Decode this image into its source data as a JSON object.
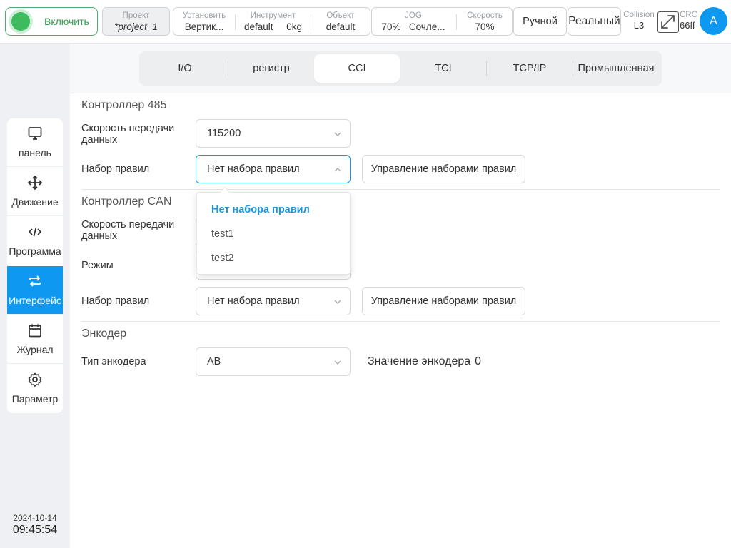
{
  "topbar": {
    "power_label": "Включить",
    "project": {
      "caption": "Проект",
      "value": "*project_1"
    },
    "install": {
      "caption": "Установить",
      "value": "Вертик..."
    },
    "tool": {
      "caption": "Инструмент",
      "value": "default",
      "load": "0kg"
    },
    "object": {
      "caption": "Объект",
      "value": "default"
    },
    "jog": {
      "caption": "JOG",
      "value": "70%",
      "mode": "Сочле..."
    },
    "speed": {
      "caption": "Скорость",
      "value": "70%"
    },
    "manual_label": "Ручной",
    "real_label": "Реальный",
    "collision": {
      "caption": "Collision",
      "value": "L3"
    },
    "crc": {
      "caption": "CRC",
      "value": "66ff"
    },
    "avatar_letter": "A"
  },
  "sidebar": {
    "items": [
      {
        "label": "панель",
        "icon": "monitor-icon"
      },
      {
        "label": "Движение",
        "icon": "move-arrows-icon"
      },
      {
        "label": "Программа",
        "icon": "code-icon"
      },
      {
        "label": "Интерфейс",
        "icon": "swap-arrows-icon"
      },
      {
        "label": "Журнал",
        "icon": "calendar-icon"
      },
      {
        "label": "Параметр",
        "icon": "gear-icon"
      }
    ],
    "active_index": 3,
    "date": "2024-10-14",
    "time": "09:45:54"
  },
  "tabs": {
    "items": [
      "I/O",
      "регистр",
      "CCI",
      "TCI",
      "TCP/IP",
      "Промышленная"
    ],
    "active_index": 2
  },
  "rs485": {
    "title": "Контроллер 485",
    "baud_label_1": "Скорость передачи",
    "baud_label_2": "данных",
    "baud_value": "115200",
    "ruleset_label": "Набор правил",
    "ruleset_value": "Нет набора правил",
    "manage_button": "Управление наборами правил"
  },
  "can": {
    "title": "Контроллер CAN",
    "baud_label_1": "Скорость передачи",
    "baud_label_2": "данных",
    "mode_label": "Режим",
    "ruleset_label": "Набор правил",
    "ruleset_value": "Нет набора правил",
    "manage_button": "Управление наборами правил"
  },
  "encoder": {
    "title": "Энкодер",
    "type_label": "Тип энкодера",
    "type_value": "AB",
    "value_label": "Значение энкодера",
    "value": "0"
  },
  "dropdown": {
    "options": [
      "Нет набора правил",
      "test1",
      "test2"
    ],
    "selected_index": 0
  },
  "colors": {
    "accent": "#0f98f0",
    "power_green": "#3dbb5e"
  }
}
